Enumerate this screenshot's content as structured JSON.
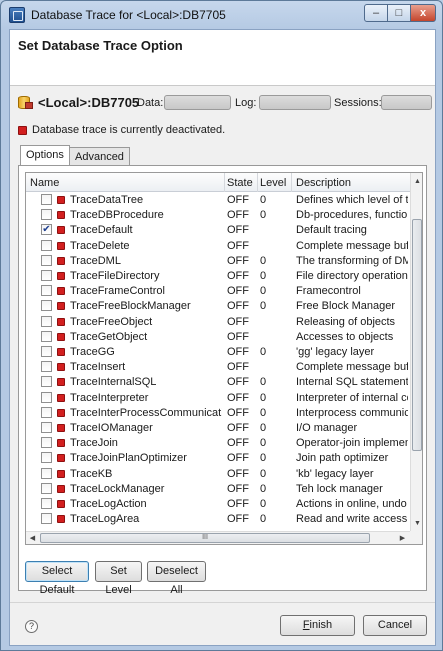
{
  "window": {
    "title": "Database Trace for <Local>:DB7705",
    "minimize_label": "–",
    "maximize_label": "□",
    "close_label": "x"
  },
  "header": {
    "heading": "Set Database Trace Option"
  },
  "connection": {
    "name": "<Local>:DB7705",
    "data_label": "Data:",
    "log_label": "Log:",
    "sessions_label": "Sessions:"
  },
  "status": {
    "text": "Database trace is currently deactivated.",
    "color": "#d21f1f"
  },
  "tabs": [
    {
      "label": "Options",
      "active": true
    },
    {
      "label": "Advanced",
      "active": false
    }
  ],
  "table": {
    "columns": {
      "name": "Name",
      "state": "State",
      "level": "Level",
      "description": "Description"
    },
    "rows": [
      {
        "name": "TraceDataTree",
        "checked": false,
        "state": "OFF",
        "level": "0",
        "description": "Defines which level of tra"
      },
      {
        "name": "TraceDBProcedure",
        "checked": false,
        "state": "OFF",
        "level": "0",
        "description": "Db-procedures, functions"
      },
      {
        "name": "TraceDefault",
        "checked": true,
        "state": "OFF",
        "level": "",
        "description": "Default tracing"
      },
      {
        "name": "TraceDelete",
        "checked": false,
        "state": "OFF",
        "level": "",
        "description": "Complete message buffe"
      },
      {
        "name": "TraceDML",
        "checked": false,
        "state": "OFF",
        "level": "0",
        "description": "The transforming of DML"
      },
      {
        "name": "TraceFileDirectory",
        "checked": false,
        "state": "OFF",
        "level": "0",
        "description": "File directory operations"
      },
      {
        "name": "TraceFrameControl",
        "checked": false,
        "state": "OFF",
        "level": "0",
        "description": "Framecontrol"
      },
      {
        "name": "TraceFreeBlockManager",
        "checked": false,
        "state": "OFF",
        "level": "0",
        "description": "Free Block Manager"
      },
      {
        "name": "TraceFreeObject",
        "checked": false,
        "state": "OFF",
        "level": "",
        "description": "Releasing of objects"
      },
      {
        "name": "TraceGetObject",
        "checked": false,
        "state": "OFF",
        "level": "",
        "description": "Accesses to objects"
      },
      {
        "name": "TraceGG",
        "checked": false,
        "state": "OFF",
        "level": "0",
        "description": "'gg' legacy layer"
      },
      {
        "name": "TraceInsert",
        "checked": false,
        "state": "OFF",
        "level": "",
        "description": "Complete message buffe"
      },
      {
        "name": "TraceInternalSQL",
        "checked": false,
        "state": "OFF",
        "level": "0",
        "description": "Internal SQL statements"
      },
      {
        "name": "TraceInterpreter",
        "checked": false,
        "state": "OFF",
        "level": "0",
        "description": "Interpreter of internal cor"
      },
      {
        "name": "TraceInterProcessCommunication",
        "checked": false,
        "state": "OFF",
        "level": "0",
        "description": "Interprocess communicat"
      },
      {
        "name": "TraceIOManager",
        "checked": false,
        "state": "OFF",
        "level": "0",
        "description": "I/O manager"
      },
      {
        "name": "TraceJoin",
        "checked": false,
        "state": "OFF",
        "level": "0",
        "description": "Operator-join implement"
      },
      {
        "name": "TraceJoinPlanOptimizer",
        "checked": false,
        "state": "OFF",
        "level": "0",
        "description": "Join path optimizer"
      },
      {
        "name": "TraceKB",
        "checked": false,
        "state": "OFF",
        "level": "0",
        "description": "'kb' legacy layer"
      },
      {
        "name": "TraceLockManager",
        "checked": false,
        "state": "OFF",
        "level": "0",
        "description": "Teh lock manager"
      },
      {
        "name": "TraceLogAction",
        "checked": false,
        "state": "OFF",
        "level": "0",
        "description": "Actions in online, undo o"
      },
      {
        "name": "TraceLogArea",
        "checked": false,
        "state": "OFF",
        "level": "0",
        "description": "Read and write access of"
      }
    ],
    "scroll_up": "▲",
    "scroll_down": "▼",
    "scroll_left": "◀",
    "scroll_right": "▶",
    "thumb_grip": "III"
  },
  "table_buttons": {
    "select_default": "Select Default",
    "set_level": "Set Level",
    "deselect_all": "Deselect All"
  },
  "footer": {
    "help_glyph": "?",
    "finish_first": "F",
    "finish_rest": "inish",
    "cancel": "Cancel"
  }
}
